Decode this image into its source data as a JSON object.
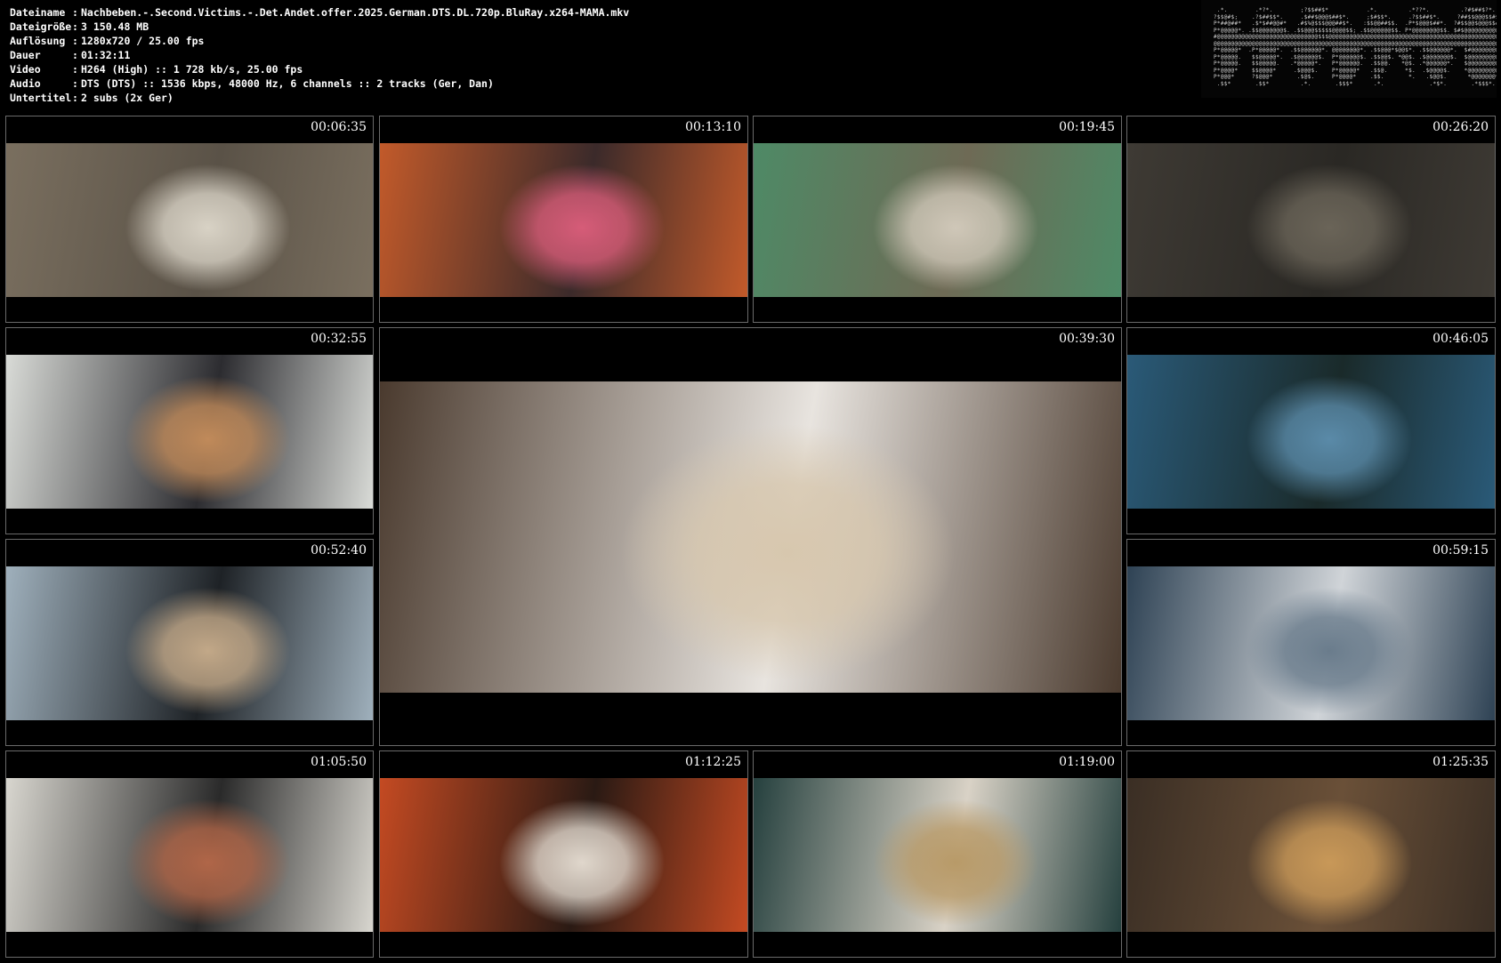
{
  "info": [
    {
      "label": "Dateiname",
      "value": "Nachbeben.-.Second.Victims.-.Det.Andet.offer.2025.German.DTS.DL.720p.BluRay.x264-MAMA.mkv"
    },
    {
      "label": "Dateigröße",
      "value": "3 150.48 MB"
    },
    {
      "label": "Auflösung",
      "value": "1280x720 / 25.00 fps"
    },
    {
      "label": "Dauer",
      "value": "01:32:11"
    },
    {
      "label": "Video",
      "value": "H264 (High) :: 1 728 kb/s, 25.00 fps"
    },
    {
      "label": "Audio",
      "value": "DTS (DTS) :: 1536 kbps, 48000 Hz, 6 channels :: 2 tracks (Ger, Dan)"
    },
    {
      "label": "Untertitel",
      "value": "2 subs (2x Ger)"
    }
  ],
  "separator": ":",
  "thumbnails": [
    {
      "time": "00:06:35",
      "colors": [
        "#7a6f5f",
        "#d8d2c5",
        "#5a5247"
      ]
    },
    {
      "time": "00:13:10",
      "colors": [
        "#c25a2a",
        "#d65c78",
        "#3b2a2a"
      ]
    },
    {
      "time": "00:19:45",
      "colors": [
        "#4e8a66",
        "#cfc7b8",
        "#6e6a55"
      ]
    },
    {
      "time": "00:26:20",
      "colors": [
        "#3e3a34",
        "#6a6458",
        "#2a2824"
      ]
    },
    {
      "time": "00:32:55",
      "colors": [
        "#d9dbd7",
        "#c08a5a",
        "#2c2c30"
      ]
    },
    {
      "time": "00:39:30",
      "colors": [
        "#4a3a2e",
        "#d7c7ae",
        "#e8e4df"
      ]
    },
    {
      "time": "00:46:05",
      "colors": [
        "#2a5a78",
        "#5a8aa8",
        "#1a2a2a"
      ]
    },
    {
      "time": "00:52:40",
      "colors": [
        "#9fb0bc",
        "#c2a888",
        "#1e2226"
      ]
    },
    {
      "time": "00:59:15",
      "colors": [
        "#2e4254",
        "#6a7c8c",
        "#d0d4d8"
      ]
    },
    {
      "time": "01:05:50",
      "colors": [
        "#d8d6cf",
        "#b06648",
        "#2a2a2a"
      ]
    },
    {
      "time": "01:12:25",
      "colors": [
        "#c44a22",
        "#e0d7cc",
        "#2a1a14"
      ]
    },
    {
      "time": "01:19:00",
      "colors": [
        "#25403e",
        "#b89a68",
        "#d9d2c6"
      ]
    },
    {
      "time": "01:25:35",
      "colors": [
        "#3a2e24",
        "#c89858",
        "#6a5038"
      ]
    }
  ]
}
